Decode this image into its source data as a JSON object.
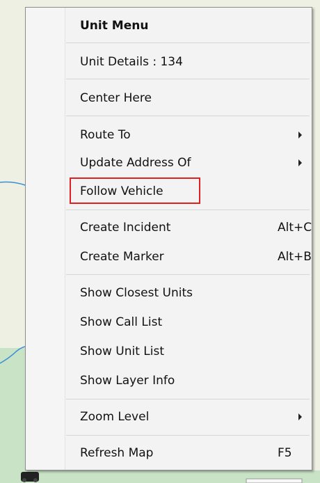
{
  "menu": {
    "header": "Unit Menu",
    "unit_details": "Unit Details : 134",
    "center_here": "Center Here",
    "route_to": "Route To",
    "update_address_of": "Update Address Of",
    "follow_vehicle": "Follow Vehicle",
    "create_incident": "Create Incident",
    "create_incident_shortcut": "Alt+C",
    "create_marker": "Create Marker",
    "create_marker_shortcut": "Alt+B",
    "show_closest_units": "Show Closest Units",
    "show_call_list": "Show Call List",
    "show_unit_list": "Show Unit List",
    "show_layer_info": "Show Layer Info",
    "zoom_level": "Zoom Level",
    "refresh_map": "Refresh Map",
    "refresh_map_shortcut": "F5"
  },
  "colors": {
    "highlight_box": "#e02020",
    "map_background": "#eef0e3",
    "map_green": "#c9e3c6",
    "map_road": "#3a8fd6"
  },
  "icons": {
    "submenu_arrow": "chevron-right-icon",
    "map_vehicle": "vehicle-icon"
  }
}
